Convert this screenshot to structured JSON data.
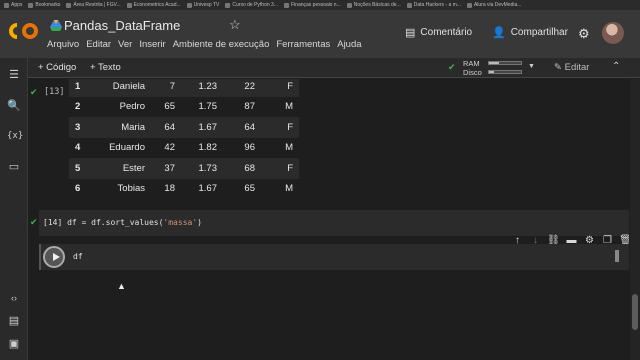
{
  "bookmarks": [
    "Apps",
    "Bookmarks",
    "Área Restrita | FGV...",
    "Econometrics Acad...",
    "Univesp TV",
    "Curso de Python 3...",
    "Finanças pessoais n...",
    "Noções Básicas de...",
    "Data Hackers - a m...",
    "Alura via DevMedia..."
  ],
  "header": {
    "title": "Pandas_DataFrame",
    "menu": [
      "Arquivo",
      "Editar",
      "Ver",
      "Inserir",
      "Ambiente de execução",
      "Ferramentas",
      "Ajuda"
    ],
    "comment": "Comentário",
    "share": "Compartilhar"
  },
  "toolbar": {
    "add_code": "+ Código",
    "add_text": "+ Texto",
    "ram_label": "RAM",
    "disk_label": "Disco",
    "ram_usage": 0.3,
    "disk_usage": 0.15,
    "edit": "Editar"
  },
  "cells": {
    "out13_label": "[13]",
    "in14_label": "[14]",
    "in14_code_a": "df = df.sort_values(",
    "in14_code_str": "'massa'",
    "in14_code_b": ")",
    "in15_code": "df"
  },
  "dataframe": {
    "rows": [
      [
        "1",
        "Daniela",
        "7",
        "1.23",
        "22",
        "F"
      ],
      [
        "2",
        "Pedro",
        "65",
        "1.75",
        "87",
        "M"
      ],
      [
        "3",
        "Maria",
        "64",
        "1.67",
        "64",
        "F"
      ],
      [
        "4",
        "Eduardo",
        "42",
        "1.82",
        "96",
        "M"
      ],
      [
        "5",
        "Ester",
        "37",
        "1.73",
        "68",
        "F"
      ],
      [
        "6",
        "Tobias",
        "18",
        "1.67",
        "65",
        "M"
      ]
    ]
  },
  "colors": {
    "background": "#1e1e1e",
    "accent_orange": "#f9ab00",
    "check_green": "#4caf50"
  }
}
